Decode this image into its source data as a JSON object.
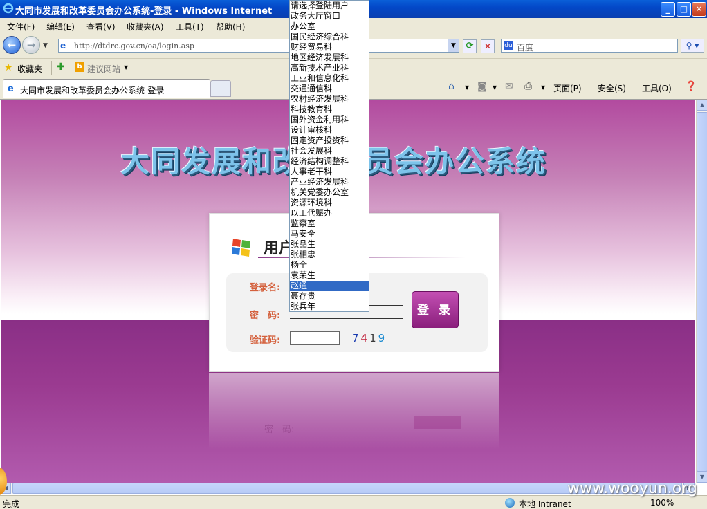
{
  "window": {
    "title": "大同市发展和改革委员会办公系统-登录 - Windows Internet",
    "buttons": {
      "minimize": "_",
      "maximize": "□",
      "close": "✕"
    }
  },
  "menubar": {
    "items": [
      "文件(F)",
      "编辑(E)",
      "查看(V)",
      "收藏夹(A)",
      "工具(T)",
      "帮助(H)"
    ]
  },
  "address": {
    "url": "http://dtdrc.gov.cn/oa/login.asp",
    "search_placeholder": "百度"
  },
  "favorites": {
    "label": "收藏夹",
    "suggested": "建议网站"
  },
  "tabs": {
    "active": "大同市发展和改革委员会办公系统-登录"
  },
  "command_bar": {
    "page": "页面(P)",
    "safety": "安全(S)",
    "tools": "工具(O)"
  },
  "page": {
    "banner_title": "大同发展和改革委员会办公系统",
    "panel_heading": "用户",
    "labels": {
      "username": "登录名:",
      "password": "密　码:",
      "captcha": "验证码:"
    },
    "captcha_code": [
      "7",
      "4",
      "1",
      "9"
    ],
    "captcha_colors": [
      "#1a3bb0",
      "#c0203a",
      "#3a3a3a",
      "#1a8ad0"
    ],
    "login_button": "登 录",
    "reflection_text": "密　码:"
  },
  "dropdown": {
    "selected_index": 27,
    "options": [
      "请选择登陆用户",
      "政务大厅窗口",
      "办公室",
      "国民经济综合科",
      "财经贸易科",
      "地区经济发展科",
      "高新技术产业科",
      "工业和信息化科",
      "交通通信科",
      "农村经济发展科",
      "科技教育科",
      "国外资金利用科",
      "设计审核科",
      "固定资产投资科",
      "社会发展科",
      "经济结构调整科",
      "人事老干科",
      "产业经济发展科",
      "机关党委办公室",
      "资源环境科",
      "以工代赈办",
      "监察室",
      "马安全",
      "张品生",
      "张相忠",
      "杨全",
      "袁荣生",
      "赵通",
      "聂存贵",
      "张兵年"
    ]
  },
  "statusbar": {
    "status": "完成",
    "zone": "本地 Intranet",
    "zoom": "100%"
  },
  "watermark": "www.wooyun.org",
  "colors": {
    "accent": "#316ac5",
    "brand_purple": "#8a2f86",
    "label_orange": "#d4603c"
  }
}
